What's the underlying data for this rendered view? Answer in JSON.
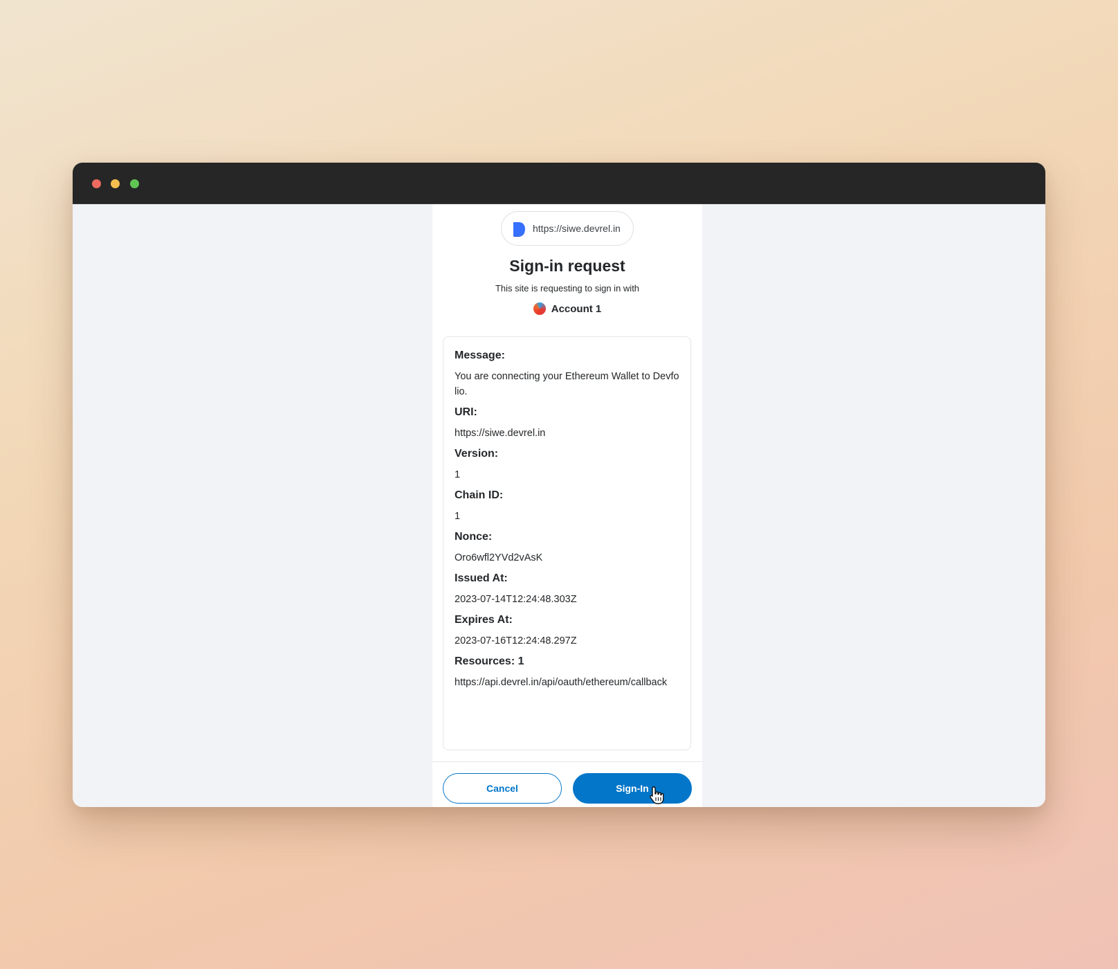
{
  "window": {
    "traffic_lights": [
      "close",
      "minimize",
      "maximize"
    ]
  },
  "popup": {
    "origin_url": "https://siwe.devrel.in",
    "origin_icon": "devfolio-logo-icon",
    "title": "Sign-in request",
    "subtitle": "This site is requesting to sign in with",
    "account_name": "Account 1",
    "account_icon": "account-avatar-icon"
  },
  "message": {
    "fields": [
      {
        "label": "Message:",
        "value": "You are connecting your Ethereum Wallet to Devfolio."
      },
      {
        "label": "URI:",
        "value": "https://siwe.devrel.in"
      },
      {
        "label": "Version:",
        "value": "1"
      },
      {
        "label": "Chain ID:",
        "value": "1"
      },
      {
        "label": "Nonce:",
        "value": "Oro6wfl2YVd2vAsK"
      },
      {
        "label": "Issued At:",
        "value": "2023-07-14T12:24:48.303Z"
      },
      {
        "label": "Expires At:",
        "value": "2023-07-16T12:24:48.297Z"
      },
      {
        "label": "Resources: 1",
        "value": "https://api.devrel.in/api/oauth/ethereum/callback"
      }
    ]
  },
  "actions": {
    "cancel_label": "Cancel",
    "signin_label": "Sign-In"
  },
  "colors": {
    "primary": "#0376c9",
    "titlebar": "#262626",
    "page_bg": "#f1f3f6"
  }
}
